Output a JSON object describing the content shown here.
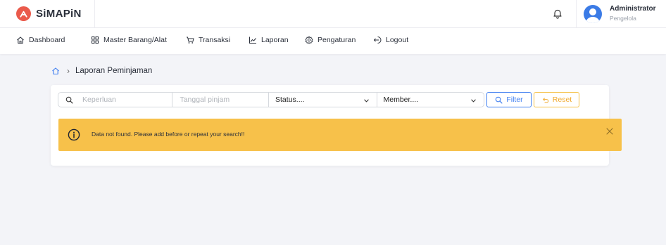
{
  "app": {
    "name": "SiMAPiN"
  },
  "user": {
    "name": "Administrator",
    "role": "Pengelola"
  },
  "nav": {
    "items": [
      {
        "label": "Dashboard",
        "icon": "home-icon"
      },
      {
        "label": "Master Barang/Alat",
        "icon": "grid-icon"
      },
      {
        "label": "Transaksi",
        "icon": "cart-icon"
      },
      {
        "label": "Laporan",
        "icon": "chart-icon"
      },
      {
        "label": "Pengaturan",
        "icon": "gear-icon"
      },
      {
        "label": "Logout",
        "icon": "logout-icon"
      }
    ]
  },
  "breadcrumb": {
    "current": "Laporan Peminjaman"
  },
  "filters": {
    "keperluan_placeholder": "Keperluan",
    "tanggal_placeholder": "Tanggal pinjam",
    "status_value": "Status....",
    "member_value": "Member....",
    "filter_label": "Filter",
    "reset_label": "Reset"
  },
  "alert": {
    "message": "Data not found. Please add before or repeat your search!!"
  },
  "colors": {
    "brand": "#ea5a4b",
    "primary": "#3d7df0",
    "warning": "#f7c14a",
    "reset": "#f0a92c"
  }
}
